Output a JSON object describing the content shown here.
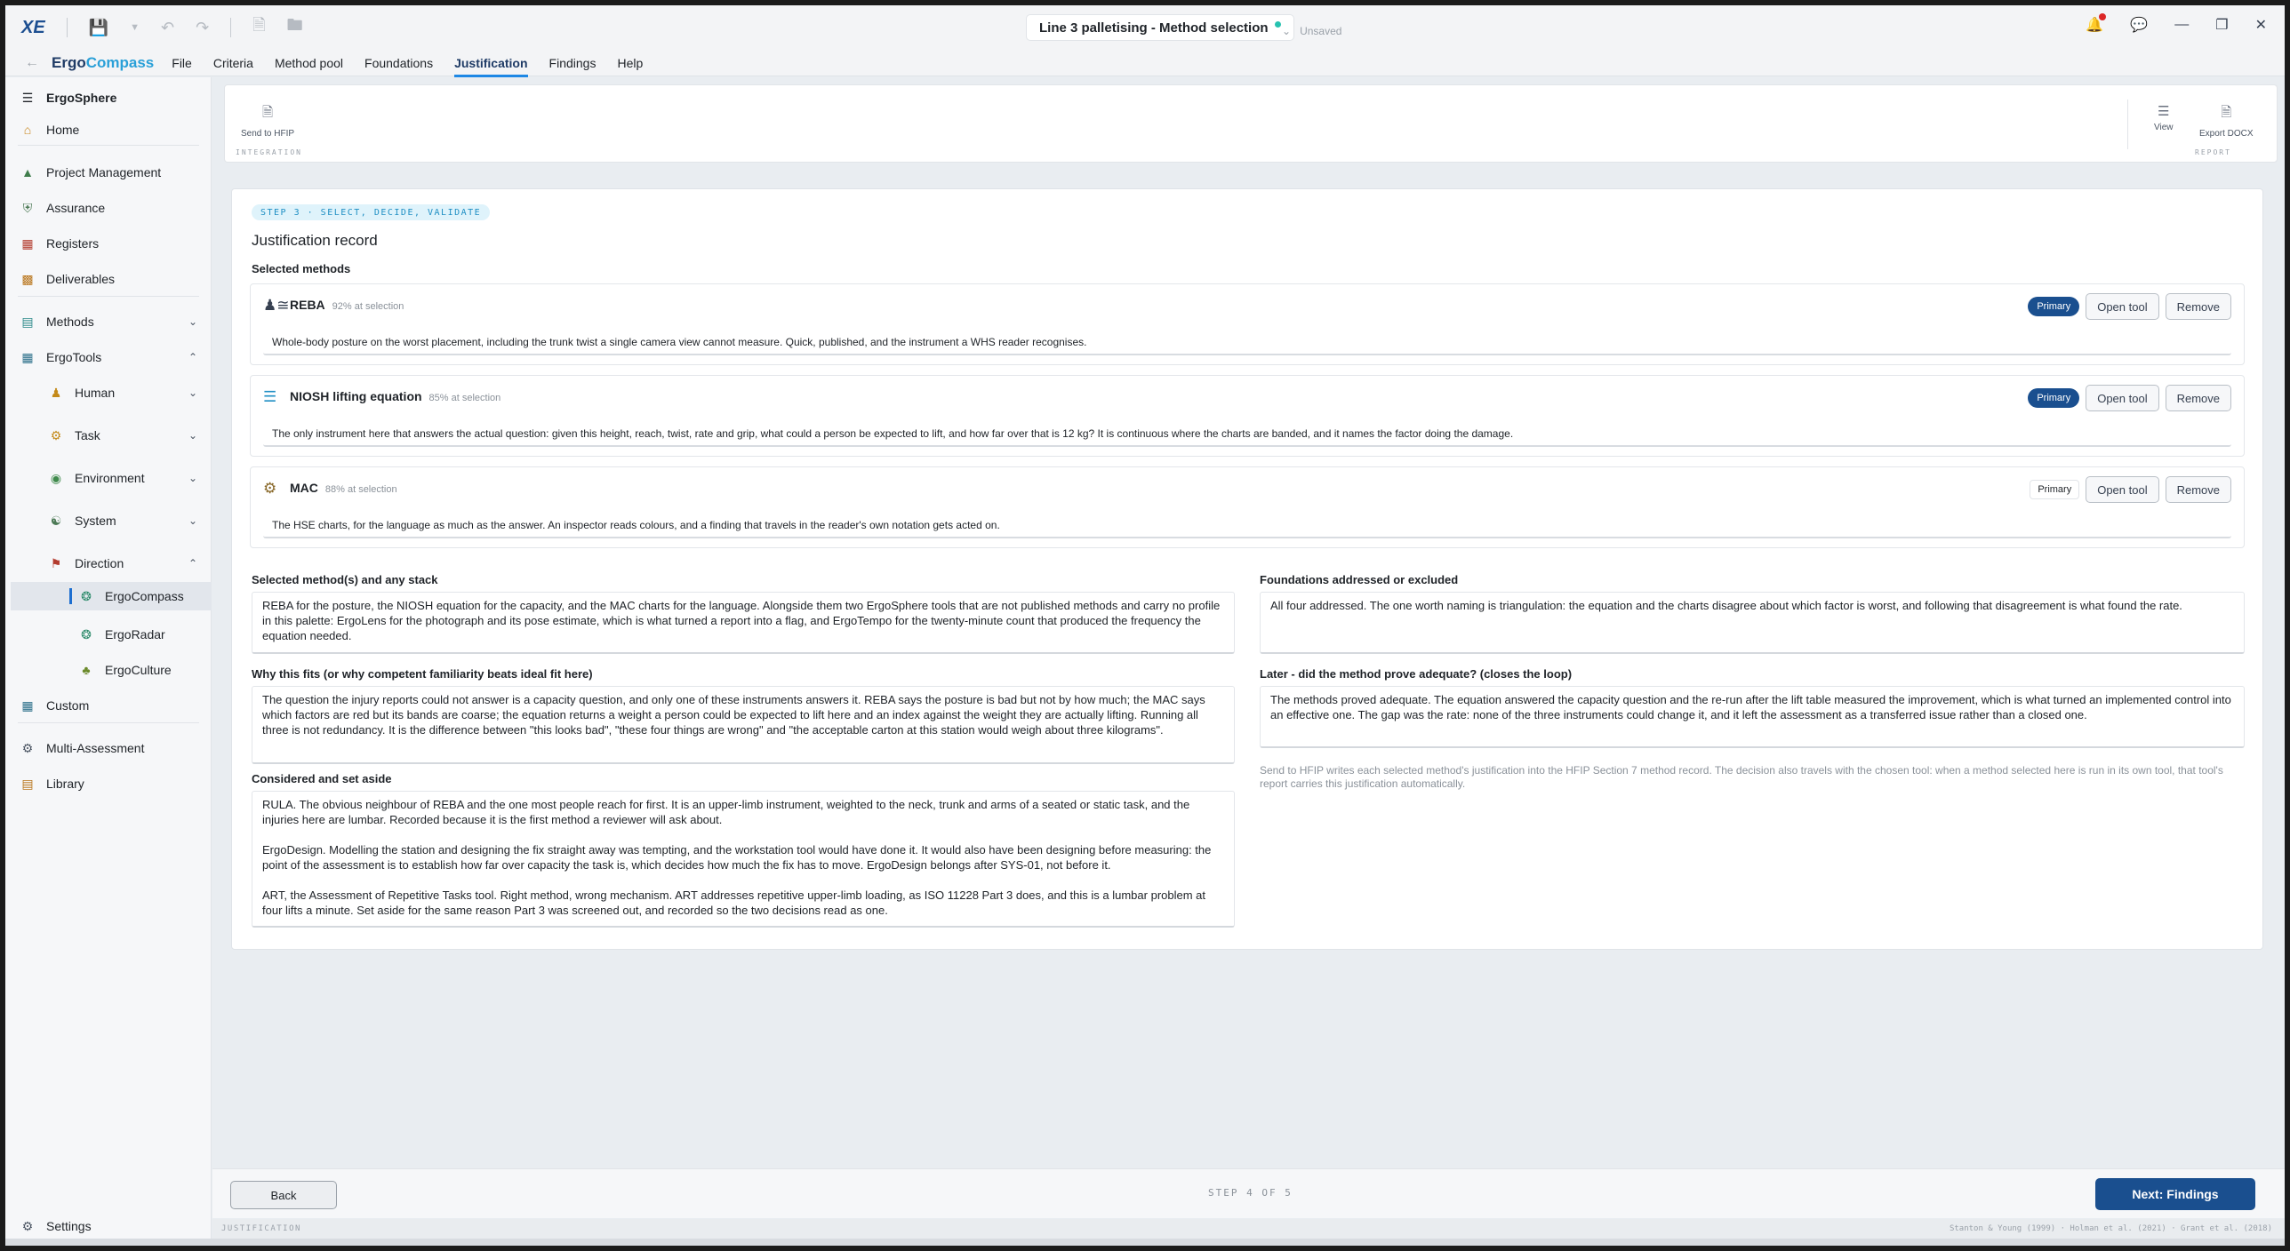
{
  "titlebar": {
    "doc_title": "Line 3 palletising - Method selection",
    "save_state": "Unsaved"
  },
  "menubar": {
    "brand_part1": "Ergo",
    "brand_part2": "Compass",
    "items": [
      "File",
      "Criteria",
      "Method pool",
      "Foundations",
      "Justification",
      "Findings",
      "Help"
    ],
    "active_item": "Justification"
  },
  "sidebar": {
    "header": "ErgoSphere",
    "items": {
      "home": "Home",
      "project_management": "Project Management",
      "assurance": "Assurance",
      "registers": "Registers",
      "deliverables": "Deliverables",
      "methods": "Methods",
      "ergotools": "ErgoTools",
      "human": "Human",
      "task": "Task",
      "environment": "Environment",
      "system": "System",
      "direction": "Direction",
      "ergocompass": "ErgoCompass",
      "ergoradar": "ErgoRadar",
      "ergoculture": "ErgoCulture",
      "custom": "Custom",
      "multi_assessment": "Multi-Assessment",
      "library": "Library",
      "settings": "Settings"
    }
  },
  "ribbon": {
    "send_label": "Send to HFIP",
    "integration_group": "INTEGRATION",
    "view_label": "View",
    "export_label": "Export DOCX",
    "report_group": "REPORT"
  },
  "main": {
    "step_pill": "STEP 3 · SELECT, DECIDE, VALIDATE",
    "title": "Justification record",
    "selected_heading": "Selected methods",
    "methods": [
      {
        "name": "REBA",
        "pct": "92% at selection",
        "primary_label": "Primary",
        "open_label": "Open tool",
        "remove_label": "Remove",
        "note": "Whole-body posture on the worst placement, including the trunk twist a single camera view cannot measure. Quick, published, and the instrument a WHS reader recognises."
      },
      {
        "name": "NIOSH lifting equation",
        "pct": "85% at selection",
        "primary_label": "Primary",
        "open_label": "Open tool",
        "remove_label": "Remove",
        "note": "The only instrument here that answers the actual question: given this height, reach, twist, rate and grip, what could a person be expected to lift, and how far over that is 12 kg? It is continuous where the charts are banded, and it names the factor doing the damage."
      },
      {
        "name": "MAC",
        "pct": "88% at selection",
        "primary_label": "Primary",
        "open_label": "Open tool",
        "remove_label": "Remove",
        "note": "The HSE charts, for the language as much as the answer. An inspector reads colours, and a finding that travels in the reader's own notation gets acted on."
      }
    ],
    "stack_label": "Selected method(s) and any stack",
    "stack_text": "REBA for the posture, the NIOSH equation for the capacity, and the MAC charts for the language. Alongside them two ErgoSphere tools that are not published methods and carry no profile in this palette: ErgoLens for the photograph and its pose estimate, which is what turned a report into a flag, and ErgoTempo for the twenty-minute count that produced the frequency the equation needed.",
    "why_label": "Why this fits (or why competent familiarity beats ideal fit here)",
    "why_text": "The question the injury reports could not answer is a capacity question, and only one of these instruments answers it. REBA says the posture is bad but not by how much; the MAC says which factors are red but its bands are coarse; the equation returns a weight a person could be expected to lift here and an index against the weight they are actually lifting. Running all three is not redundancy. It is the difference between \"this looks bad\", \"these four things are wrong\" and \"the acceptable carton at this station would weigh about three kilograms\".",
    "considered_label": "Considered and set aside",
    "considered_text": "RULA. The obvious neighbour of REBA and the one most people reach for first. It is an upper-limb instrument, weighted to the neck, trunk and arms of a seated or static task, and the injuries here are lumbar. Recorded because it is the first method a reviewer will ask about.\n\nErgoDesign. Modelling the station and designing the fix straight away was tempting, and the workstation tool would have done it. It would also have been designing before measuring: the point of the assessment is to establish how far over capacity the task is, which decides how much the fix has to move. ErgoDesign belongs after SYS-01, not before it.\n\nART, the Assessment of Repetitive Tasks tool. Right method, wrong mechanism. ART addresses repetitive upper-limb loading, as ISO 11228 Part 3 does, and this is a lumbar problem at four lifts a minute. Set aside for the same reason Part 3 was screened out, and recorded so the two decisions read as one.",
    "foundations_label": "Foundations addressed or excluded",
    "foundations_text": "All four addressed. The one worth naming is triangulation: the equation and the charts disagree about which factor is worst, and following that disagreement is what found the rate.",
    "later_label": "Later - did the method prove adequate? (closes the loop)",
    "later_text": "The methods proved adequate. The equation answered the capacity question and the re-run after the lift table measured the improvement, which is what turned an implemented control into an effective one. The gap was the rate: none of the three instruments could change it, and it left the assessment as a transferred issue rather than a closed one.",
    "hfip_note": "Send to HFIP writes each selected method's justification into the HFIP Section 7 method record. The decision also travels with the chosen tool: when a method selected here is run in its own tool, that tool's report carries this justification automatically."
  },
  "footer": {
    "back_label": "Back",
    "step_of": "STEP 4 OF 5",
    "next_label": "Next: Findings"
  },
  "statusbar": {
    "left": "JUSTIFICATION",
    "right": "Stanton & Young (1999) · Holman et al. (2021) · Grant et al. (2018)"
  },
  "colors": {
    "accent": "#1a4f8f",
    "tab_underline": "#1e88e5",
    "brand_light": "#2aa0d8",
    "status_dot": "#27c2b0"
  }
}
